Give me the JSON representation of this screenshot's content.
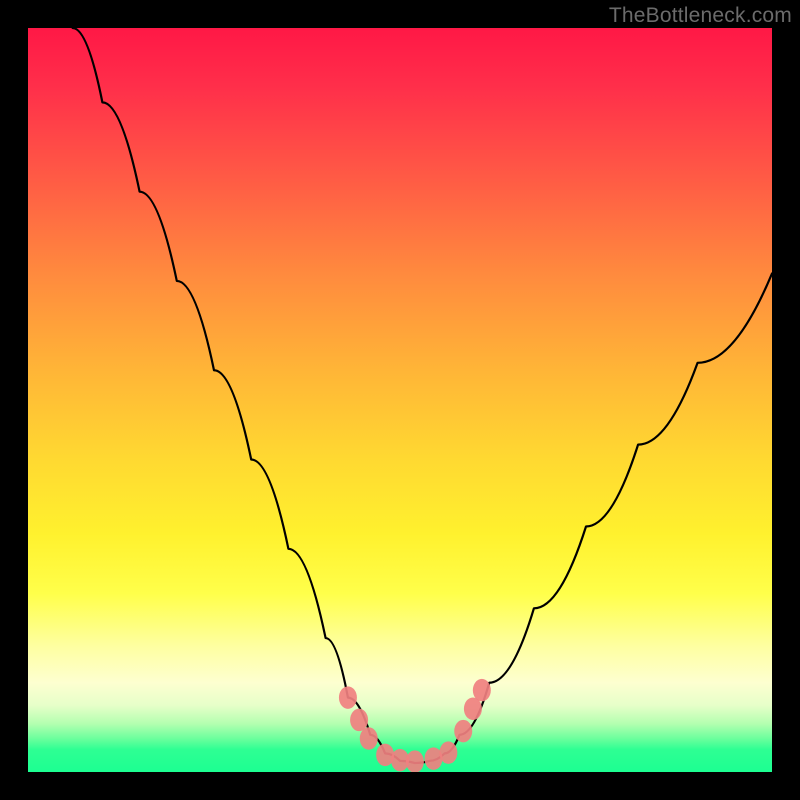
{
  "watermark": "TheBottleneck.com",
  "chart_data": {
    "type": "line",
    "title": "",
    "xlabel": "",
    "ylabel": "",
    "xlim": [
      0,
      100
    ],
    "ylim": [
      0,
      100
    ],
    "grid": false,
    "legend": false,
    "series": [
      {
        "name": "bottleneck-curve",
        "x": [
          6,
          10,
          15,
          20,
          25,
          30,
          35,
          40,
          43,
          46,
          48,
          50,
          52,
          54,
          56,
          58,
          62,
          68,
          75,
          82,
          90,
          100
        ],
        "y": [
          100,
          90,
          78,
          66,
          54,
          42,
          30,
          18,
          10,
          5,
          2.5,
          1.5,
          1.2,
          1.5,
          2.5,
          5,
          12,
          22,
          33,
          44,
          55,
          67
        ],
        "color": "#000000",
        "width": 2.2
      }
    ],
    "markers": {
      "name": "highlight-dots",
      "color": "#f08080",
      "opacity": 0.92,
      "radius": 9,
      "points": [
        {
          "x": 43.0,
          "y": 10.0
        },
        {
          "x": 44.5,
          "y": 7.0
        },
        {
          "x": 45.8,
          "y": 4.5
        },
        {
          "x": 48.0,
          "y": 2.3
        },
        {
          "x": 50.0,
          "y": 1.6
        },
        {
          "x": 52.0,
          "y": 1.4
        },
        {
          "x": 54.5,
          "y": 1.8
        },
        {
          "x": 56.5,
          "y": 2.6
        },
        {
          "x": 58.5,
          "y": 5.5
        },
        {
          "x": 59.8,
          "y": 8.5
        },
        {
          "x": 61.0,
          "y": 11.0
        }
      ]
    },
    "background_gradient": {
      "stops": [
        {
          "pos": 0.0,
          "color": "#ff1846"
        },
        {
          "pos": 0.2,
          "color": "#ff5a45"
        },
        {
          "pos": 0.46,
          "color": "#ffb537"
        },
        {
          "pos": 0.68,
          "color": "#fff12e"
        },
        {
          "pos": 0.88,
          "color": "#fdffd0"
        },
        {
          "pos": 1.0,
          "color": "#1cff92"
        }
      ]
    }
  }
}
